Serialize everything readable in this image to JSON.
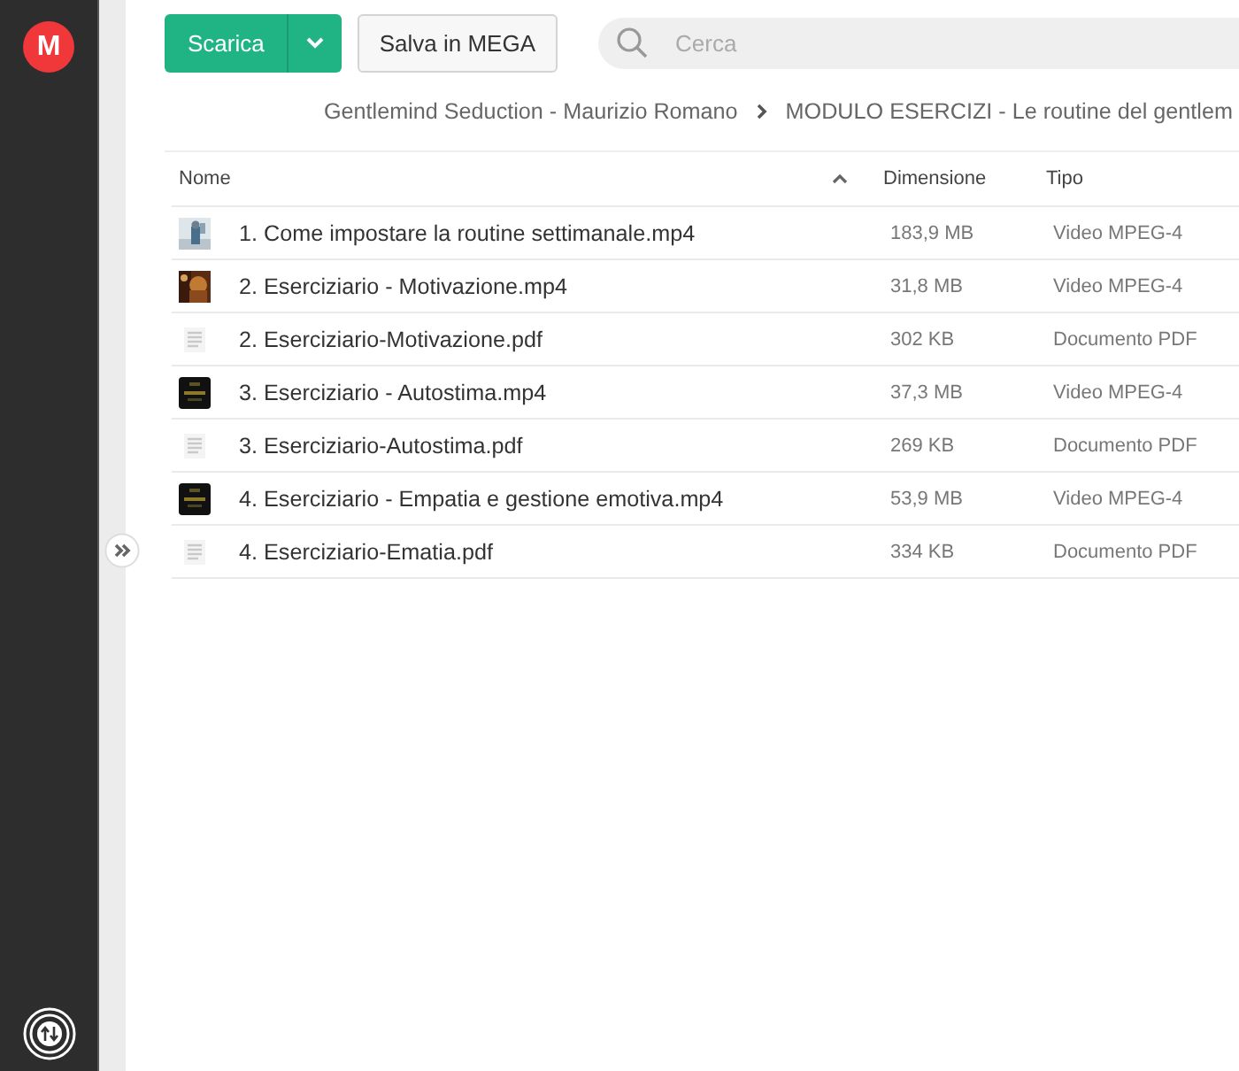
{
  "sidebar": {
    "logo": "M"
  },
  "toolbar": {
    "download_button": "Scarica",
    "save_button": "Salva in MEGA",
    "search": {
      "placeholder": "Cerca"
    }
  },
  "breadcrumb": [
    "Gentlemind Seduction - Maurizio Romano",
    "MODULO ESERCIZI - Le routine del gentlem"
  ],
  "table": {
    "columns": [
      {
        "label": "Nome",
        "sorted": true
      },
      {
        "label": "Dimensione",
        "sorted": false
      },
      {
        "label": "Tipo",
        "sorted": false
      }
    ],
    "rows": [
      {
        "kind": "video",
        "name": "1. Come impostare la routine settimanale.mp4",
        "size": "183,9 MB",
        "type": "Video MPEG-4"
      },
      {
        "kind": "video",
        "name": "2. Eserciziario - Motivazione.mp4",
        "size": "31,8 MB",
        "type": "Video MPEG-4"
      },
      {
        "kind": "pdf",
        "name": "2. Eserciziario-Motivazione.pdf",
        "size": "302 KB",
        "type": "Documento PDF"
      },
      {
        "kind": "video",
        "name": "3. Eserciziario - Autostima.mp4",
        "size": "37,3 MB",
        "type": "Video MPEG-4"
      },
      {
        "kind": "pdf",
        "name": "3. Eserciziario-Autostima.pdf",
        "size": "269 KB",
        "type": "Documento PDF"
      },
      {
        "kind": "video",
        "name": "4. Eserciziario - Empatia e gestione emotiva.mp4",
        "size": "53,9 MB",
        "type": "Video MPEG-4"
      },
      {
        "kind": "pdf",
        "name": "4. Eserciziario-Ematia.pdf",
        "size": "334 KB",
        "type": "Documento PDF"
      }
    ]
  }
}
